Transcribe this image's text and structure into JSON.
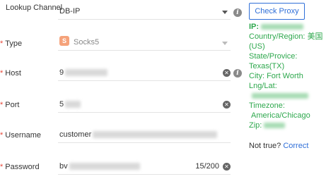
{
  "form": {
    "lookup_channel": {
      "label": "Lookup Channel",
      "value": "DB-IP"
    },
    "type": {
      "label": "Type",
      "value": "Socks5",
      "icon_letter": "S"
    },
    "host": {
      "label": "Host",
      "value_prefix": "9"
    },
    "port": {
      "label": "Port",
      "value_prefix": "5"
    },
    "username": {
      "label": "Username",
      "value_prefix": "customer"
    },
    "password": {
      "label": "Password",
      "value_prefix": "bv",
      "counter": "15/200"
    },
    "required_mark": "*"
  },
  "check_proxy": {
    "label": "Check Proxy"
  },
  "result": {
    "ip_label": "IP:",
    "country_label": "Country/Region:",
    "country_name": "美国",
    "country_code": "(US)",
    "state_label": "State/Provice:",
    "state_value": "Texas(TX)",
    "city_label": "City:",
    "city_value": "Fort Worth",
    "lnglat_label": "Lng/Lat:",
    "timezone_label": "Timezone:",
    "timezone_value": "America/Chicago",
    "zip_label": "Zip:"
  },
  "footer": {
    "not_true": "Not true?",
    "correct": "Correct"
  },
  "colors": {
    "accent": "#2f6fd8",
    "success": "#2ea84d",
    "required": "#e8483a"
  },
  "icons": {
    "clear": "clear-icon",
    "info": "info-icon",
    "dropdown": "chevron-down-icon",
    "socks": "socks-icon"
  }
}
